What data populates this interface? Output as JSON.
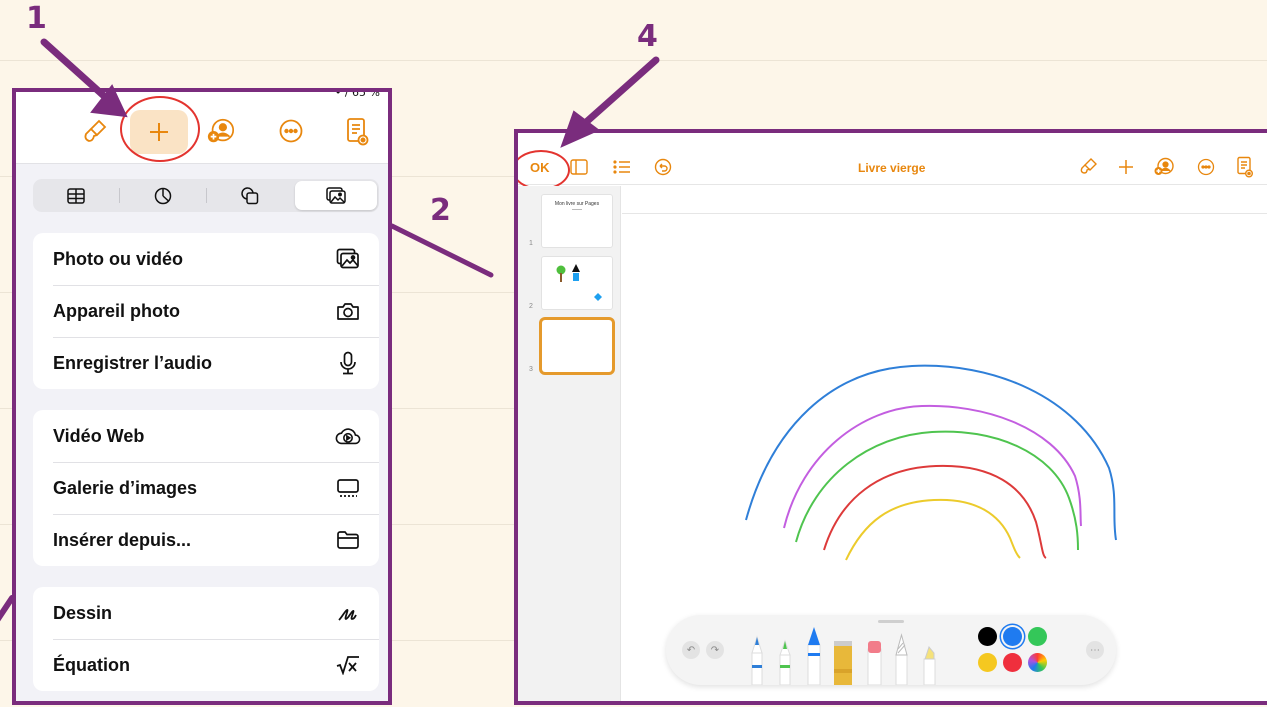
{
  "annotations": {
    "n1": "1",
    "n2": "2",
    "n4": "4"
  },
  "colors": {
    "annotation": "#7a2c7d",
    "accent_orange": "#e8870e",
    "highlight_circle": "#e3342f",
    "rainbow": [
      "#2f7fd8",
      "#c35ee0",
      "#4fc44f",
      "#dd3a3a",
      "#eccb2c"
    ]
  },
  "insert_panel": {
    "status_text": "• / 65 %",
    "toolbar_icons": [
      "paintbrush-icon",
      "plus-icon",
      "collaborate-icon",
      "more-icon",
      "document-icon"
    ],
    "segmented_tabs": [
      "table-icon",
      "chart-icon",
      "shapes-icon",
      "media-icon"
    ],
    "selected_tab": "media-icon",
    "groups": [
      [
        {
          "label": "Photo ou vidéo",
          "icon": "photo-icon"
        },
        {
          "label": "Appareil photo",
          "icon": "camera-icon"
        },
        {
          "label": "Enregistrer l’audio",
          "icon": "microphone-icon"
        }
      ],
      [
        {
          "label": "Vidéo Web",
          "icon": "cloud-play-icon"
        },
        {
          "label": "Galerie d’images",
          "icon": "image-gallery-icon"
        },
        {
          "label": "Insérer depuis...",
          "icon": "folder-icon"
        }
      ],
      [
        {
          "label": "Dessin",
          "icon": "pencil-scribble-icon"
        },
        {
          "label": "Équation",
          "icon": "square-root-icon"
        }
      ]
    ]
  },
  "drawing_panel": {
    "ok_label": "OK",
    "document_title": "Livre vierge",
    "thumbnails": [
      {
        "number": "1",
        "title": "Mon livre sur Pages"
      },
      {
        "number": "2"
      },
      {
        "number": "3",
        "selected": true
      }
    ],
    "pen_tools": [
      "pen",
      "marker",
      "crayon",
      "fill-bucket",
      "eraser",
      "pencil",
      "lasso-highlighter"
    ],
    "swatches": [
      "#000000",
      "#1f7bf0",
      "#34c759",
      "#f5c820",
      "#ef2f3d",
      "rainbow"
    ],
    "selected_swatch": "#1f7bf0"
  }
}
